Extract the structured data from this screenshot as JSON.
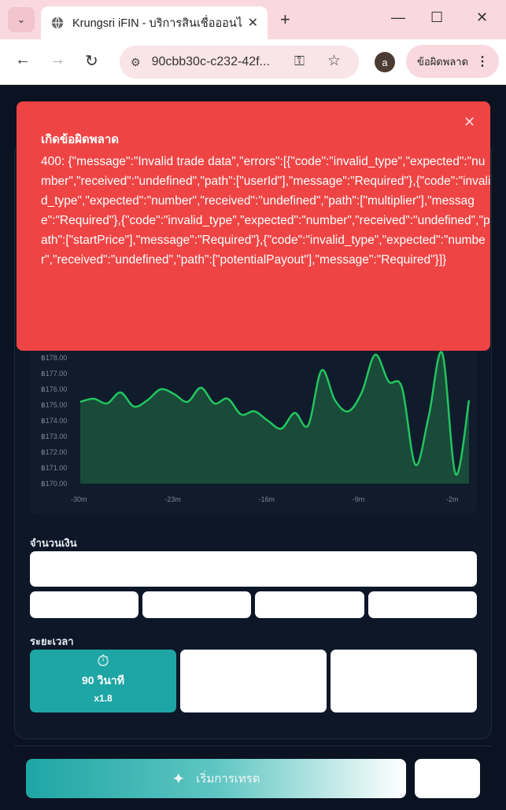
{
  "browser": {
    "tab_title": "Krungsri iFIN - บริการสินเชื่อออนไลน์",
    "url": "90cbb30c-c232-42f...",
    "profile_initial": "a",
    "error_chip_label": "ข้อผิดพลาด"
  },
  "error_banner": {
    "title": "เกิดข้อผิดพลาด",
    "message": "400: {\"message\":\"Invalid trade data\",\"errors\":[{\"code\":\"invalid_type\",\"expected\":\"number\",\"received\":\"undefined\",\"path\":[\"userId\"],\"message\":\"Required\"},{\"code\":\"invalid_type\",\"expected\":\"number\",\"received\":\"undefined\",\"path\":[\"multiplier\"],\"message\":\"Required\"},{\"code\":\"invalid_type\",\"expected\":\"number\",\"received\":\"undefined\",\"path\":[\"startPrice\"],\"message\":\"Required\"},{\"code\":\"invalid_type\",\"expected\":\"number\",\"received\":\"undefined\",\"path\":[\"potentialPayout\"],\"message\":\"Required\"}]}"
  },
  "chart_data": {
    "type": "area",
    "y_tick_labels": [
      "฿178.00",
      "฿177.00",
      "฿176.00",
      "฿175.00",
      "฿174.00",
      "฿173.00",
      "฿172.00",
      "฿171.00",
      "฿170.00"
    ],
    "x_tick_labels": [
      "-30m",
      "-23m",
      "-16m",
      "-9m",
      "-2m"
    ],
    "ylim": [
      170,
      178
    ],
    "series": [
      {
        "color": "#22c55e",
        "x": [
          -30,
          -29,
          -28,
          -27,
          -26,
          -25,
          -24,
          -23,
          -22,
          -21,
          -20,
          -19,
          -18,
          -17,
          -16,
          -15,
          -14,
          -13,
          -12,
          -11,
          -10,
          -9,
          -8,
          -7,
          -6,
          -5,
          -4,
          -3,
          -2,
          -1
        ],
        "values": [
          175.2,
          175.4,
          175.1,
          175.8,
          174.9,
          175.3,
          176.0,
          175.7,
          175.2,
          176.1,
          175.1,
          175.4,
          174.4,
          174.6,
          174.0,
          173.5,
          174.5,
          173.7,
          177.2,
          175.3,
          174.6,
          175.8,
          178.2,
          176.5,
          176.1,
          171.2,
          174.3,
          178.3,
          170.6,
          175.3
        ]
      }
    ]
  },
  "form": {
    "amount_label": "จำนวนเงิน",
    "duration_label": "ระยะเวลา",
    "duration_selected": {
      "title": "90 วินาที",
      "multiplier": "x1.8"
    },
    "start_button_label": "เริ่มการเทรด"
  }
}
